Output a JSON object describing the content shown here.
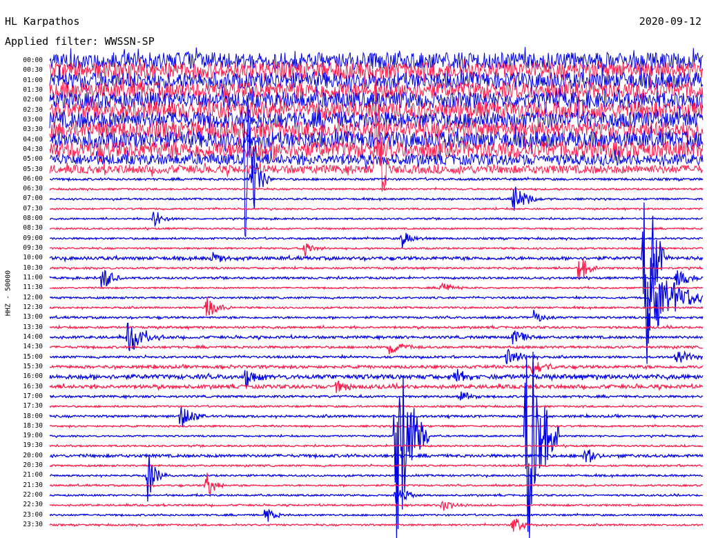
{
  "header": {
    "station": "HL Karpathos",
    "date": "2020-09-12",
    "filter": "Applied filter: WWSSN-SP"
  },
  "chart_data": {
    "type": "line",
    "ylabel": "HHZ - 50000",
    "tick_labels": [
      "00:00",
      "00:30",
      "01:00",
      "01:30",
      "02:00",
      "02:30",
      "03:00",
      "03:30",
      "04:00",
      "04:30",
      "05:00",
      "05:30",
      "06:00",
      "06:30",
      "07:00",
      "07:30",
      "08:00",
      "08:30",
      "09:00",
      "09:30",
      "10:00",
      "10:30",
      "11:00",
      "11:30",
      "12:00",
      "12:30",
      "13:00",
      "13:30",
      "14:00",
      "14:30",
      "15:00",
      "15:30",
      "16:00",
      "16:30",
      "17:00",
      "17:30",
      "18:00",
      "18:30",
      "19:00",
      "19:30",
      "20:00",
      "20:30",
      "21:00",
      "21:30",
      "22:00",
      "22:30",
      "23:00",
      "23:30"
    ],
    "series_colors": [
      "#0000e6",
      "#ff1a4a"
    ],
    "noise_levels": [
      12,
      12,
      12,
      12,
      12,
      12,
      12,
      12,
      12,
      12,
      8,
      6,
      1.5,
      1.2,
      1.2,
      1.1,
      1.1,
      1.1,
      1.3,
      1.2,
      2.2,
      1.3,
      1.4,
      1.1,
      1.3,
      1.2,
      1.4,
      1.5,
      1.8,
      1.6,
      1.5,
      2,
      3,
      2.5,
      1.5,
      1.2,
      1.5,
      1.2,
      1.1,
      1.2,
      2,
      1.2,
      1.3,
      1.2,
      1.2,
      1.2,
      1.2,
      1.2
    ],
    "events": [
      {
        "row": 10,
        "x": 0.3,
        "amp": 170,
        "dur": 0.02
      },
      {
        "row": 11,
        "x": 0.5,
        "amp": 230,
        "dur": 0.02
      },
      {
        "row": 12,
        "x": 0.31,
        "amp": 60,
        "dur": 0.03
      },
      {
        "row": 14,
        "x": 0.71,
        "amp": 20,
        "dur": 0.06
      },
      {
        "row": 16,
        "x": 0.16,
        "amp": 15,
        "dur": 0.04
      },
      {
        "row": 18,
        "x": 0.54,
        "amp": 14,
        "dur": 0.04
      },
      {
        "row": 19,
        "x": 0.39,
        "amp": 12,
        "dur": 0.04
      },
      {
        "row": 20,
        "x": 0.25,
        "amp": 10,
        "dur": 0.06
      },
      {
        "row": 20,
        "x": 0.91,
        "amp": 250,
        "dur": 0.03
      },
      {
        "row": 21,
        "x": 0.81,
        "amp": 28,
        "dur": 0.03
      },
      {
        "row": 22,
        "x": 0.08,
        "amp": 20,
        "dur": 0.04
      },
      {
        "row": 22,
        "x": 0.96,
        "amp": 14,
        "dur": 0.05
      },
      {
        "row": 23,
        "x": 0.6,
        "amp": 10,
        "dur": 0.04
      },
      {
        "row": 24,
        "x": 0.92,
        "amp": 60,
        "dur": 0.1
      },
      {
        "row": 25,
        "x": 0.24,
        "amp": 18,
        "dur": 0.04
      },
      {
        "row": 26,
        "x": 0.74,
        "amp": 12,
        "dur": 0.04
      },
      {
        "row": 28,
        "x": 0.12,
        "amp": 28,
        "dur": 0.06
      },
      {
        "row": 28,
        "x": 0.71,
        "amp": 14,
        "dur": 0.04
      },
      {
        "row": 29,
        "x": 0.52,
        "amp": 12,
        "dur": 0.05
      },
      {
        "row": 30,
        "x": 0.7,
        "amp": 18,
        "dur": 0.05
      },
      {
        "row": 30,
        "x": 0.96,
        "amp": 14,
        "dur": 0.05
      },
      {
        "row": 31,
        "x": 0.74,
        "amp": 20,
        "dur": 0.04
      },
      {
        "row": 32,
        "x": 0.3,
        "amp": 14,
        "dur": 0.05
      },
      {
        "row": 32,
        "x": 0.62,
        "amp": 12,
        "dur": 0.05
      },
      {
        "row": 33,
        "x": 0.44,
        "amp": 14,
        "dur": 0.04
      },
      {
        "row": 34,
        "x": 0.63,
        "amp": 10,
        "dur": 0.04
      },
      {
        "row": 36,
        "x": 0.2,
        "amp": 18,
        "dur": 0.05
      },
      {
        "row": 38,
        "x": 0.53,
        "amp": 200,
        "dur": 0.05
      },
      {
        "row": 38,
        "x": 0.73,
        "amp": 230,
        "dur": 0.05
      },
      {
        "row": 40,
        "x": 0.82,
        "amp": 16,
        "dur": 0.04
      },
      {
        "row": 42,
        "x": 0.15,
        "amp": 40,
        "dur": 0.03
      },
      {
        "row": 43,
        "x": 0.24,
        "amp": 22,
        "dur": 0.03
      },
      {
        "row": 44,
        "x": 0.53,
        "amp": 14,
        "dur": 0.05
      },
      {
        "row": 45,
        "x": 0.6,
        "amp": 12,
        "dur": 0.04
      },
      {
        "row": 46,
        "x": 0.33,
        "amp": 12,
        "dur": 0.04
      },
      {
        "row": 47,
        "x": 0.71,
        "amp": 14,
        "dur": 0.04
      }
    ]
  }
}
